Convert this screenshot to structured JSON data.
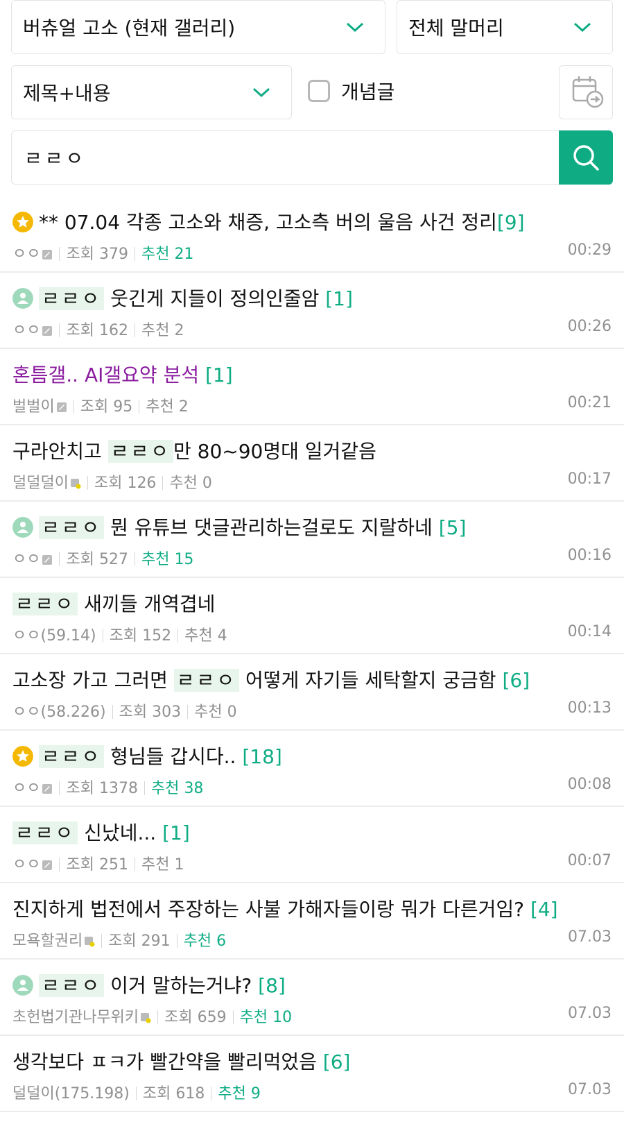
{
  "filters": {
    "gallery_select": "버츄얼 고소 (현재 갤러리)",
    "header_select": "전체 말머리",
    "search_type_select": "제목+내용",
    "recommended_only_label": "개념글"
  },
  "search": {
    "value": "ㄹㄹㅇ"
  },
  "posts": [
    {
      "icon": "star",
      "prefix": "",
      "hl": "",
      "title": "** 07.04 각종 고소와 채증, 고소측 버의 울음 사건 정리",
      "comments": "[9]",
      "author": "ㅇㅇ",
      "author_ip": "",
      "nick_icon": "fixed",
      "views": "조회 379",
      "rec": "추천 ",
      "rec_num": "21",
      "rec_green": true,
      "time": "00:29",
      "purple": false
    },
    {
      "icon": "image",
      "prefix": "",
      "hl": "ㄹㄹㅇ",
      "title": " 웃긴게 지들이 정의인줄암  ",
      "comments": "[1]",
      "author": "ㅇㅇ",
      "author_ip": "",
      "nick_icon": "fixed",
      "views": "조회 162",
      "rec": "추천 ",
      "rec_num": "2",
      "rec_green": false,
      "time": "00:26",
      "purple": false
    },
    {
      "icon": "",
      "prefix": "",
      "hl": "",
      "title": "혼틈갤.. AI갤요약 분석 ",
      "comments": "[1]",
      "author": "벌벌이",
      "author_ip": "",
      "nick_icon": "fixed",
      "views": "조회 95",
      "rec": "추천 ",
      "rec_num": "2",
      "rec_green": false,
      "time": "00:21",
      "purple": true
    },
    {
      "icon": "",
      "prefix": "구라안치고 ",
      "hl": "ㄹㄹㅇ",
      "title": "만 80~90명대 일거같음",
      "comments": "",
      "author": "덜덜덜이",
      "author_ip": "",
      "nick_icon": "sub",
      "views": "조회 126",
      "rec": "추천 ",
      "rec_num": "0",
      "rec_green": false,
      "time": "00:17",
      "purple": false
    },
    {
      "icon": "image",
      "prefix": "",
      "hl": "ㄹㄹㅇ",
      "title": " 뭔 유튜브 댓글관리하는걸로도 지랄하네 ",
      "comments": "[5]",
      "author": "ㅇㅇ",
      "author_ip": "",
      "nick_icon": "fixed",
      "views": "조회 527",
      "rec": "추천 ",
      "rec_num": "15",
      "rec_green": true,
      "time": "00:16",
      "purple": false
    },
    {
      "icon": "",
      "prefix": "",
      "hl": "ㄹㄹㅇ",
      "title": " 새끼들 개역겹네",
      "comments": "",
      "author": "ㅇㅇ",
      "author_ip": "(59.14)",
      "nick_icon": "",
      "views": "조회 152",
      "rec": "추천 ",
      "rec_num": "4",
      "rec_green": false,
      "time": "00:14",
      "purple": false
    },
    {
      "icon": "",
      "prefix": "고소장 가고 그러면 ",
      "hl": "ㄹㄹㅇ",
      "title": " 어떻게 자기들 세탁할지 궁금함 ",
      "comments": "[6]",
      "author": "ㅇㅇ",
      "author_ip": "(58.226)",
      "nick_icon": "",
      "views": "조회 303",
      "rec": "추천 ",
      "rec_num": "0",
      "rec_green": false,
      "time": "00:13",
      "purple": false
    },
    {
      "icon": "star",
      "prefix": "",
      "hl": "ㄹㄹㅇ",
      "title": " 형님들 갑시다.. ",
      "comments": "[18]",
      "author": "ㅇㅇ",
      "author_ip": "",
      "nick_icon": "fixed",
      "views": "조회 1378",
      "rec": "추천 ",
      "rec_num": "38",
      "rec_green": true,
      "time": "00:08",
      "purple": false
    },
    {
      "icon": "",
      "prefix": "",
      "hl": "ㄹㄹㅇ",
      "title": " 신났네... ",
      "comments": "[1]",
      "author": "ㅇㅇ",
      "author_ip": "",
      "nick_icon": "fixed",
      "views": "조회 251",
      "rec": "추천 ",
      "rec_num": "1",
      "rec_green": false,
      "time": "00:07",
      "purple": false
    },
    {
      "icon": "",
      "prefix": "",
      "hl": "",
      "title": "진지하게 법전에서 주장하는 사불 가해자들이랑 뭐가 다른거임? ",
      "comments": "[4]",
      "author": "모욕할권리",
      "author_ip": "",
      "nick_icon": "sub",
      "views": "조회 291",
      "rec": "추천 ",
      "rec_num": "6",
      "rec_green": true,
      "time": "07.03",
      "purple": false
    },
    {
      "icon": "image",
      "prefix": "",
      "hl": "ㄹㄹㅇ",
      "title": " 이거 말하는거냐? ",
      "comments": "[8]",
      "author": "초헌법기관나무위키",
      "author_ip": "",
      "nick_icon": "sub",
      "views": "조회 659",
      "rec": "추천 ",
      "rec_num": "10",
      "rec_green": true,
      "time": "07.03",
      "purple": false
    },
    {
      "icon": "",
      "prefix": "",
      "hl": "",
      "title": "생각보다 ㅍㅋ가 빨간약을 빨리먹었음 ",
      "comments": "[6]",
      "author": "덜덜이",
      "author_ip": "(175.198)",
      "nick_icon": "",
      "views": "조회 618",
      "rec": "추천 ",
      "rec_num": "9",
      "rec_green": true,
      "time": "07.03",
      "purple": false
    }
  ],
  "colors": {
    "accent": "#0fac84",
    "star": "#f5b800",
    "image_icon": "#9fd9bb",
    "purple_title": "#8a1a9e"
  }
}
